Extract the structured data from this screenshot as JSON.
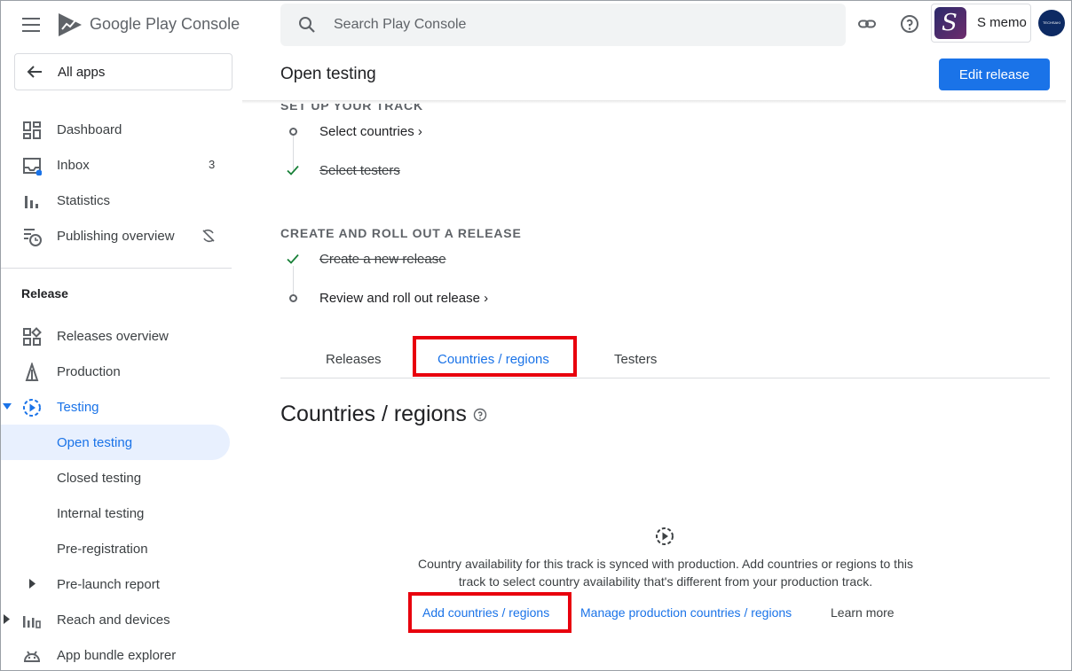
{
  "brand": {
    "name": "Google Play Console"
  },
  "sidebar": {
    "all_apps": "All apps",
    "items": [
      {
        "label": "Dashboard"
      },
      {
        "label": "Inbox",
        "count": "3"
      },
      {
        "label": "Statistics"
      },
      {
        "label": "Publishing overview"
      }
    ],
    "section_release": "Release",
    "release_items": [
      {
        "label": "Releases overview"
      },
      {
        "label": "Production"
      },
      {
        "label": "Testing"
      },
      {
        "label": "Open testing"
      },
      {
        "label": "Closed testing"
      },
      {
        "label": "Internal testing"
      },
      {
        "label": "Pre-registration"
      },
      {
        "label": "Pre-launch report"
      },
      {
        "label": "Reach and devices"
      },
      {
        "label": "App bundle explorer"
      }
    ]
  },
  "topbar": {
    "search_placeholder": "Search Play Console",
    "app_name": "S memo",
    "app_icon_letter": "S",
    "avatar_text": "TECHSAKI"
  },
  "header": {
    "title": "Open testing",
    "edit_release": "Edit release"
  },
  "steps": {
    "setup_heading": "SET UP YOUR TRACK",
    "select_countries": "Select countries ›",
    "select_testers": "Select testers",
    "rollout_heading": "CREATE AND ROLL OUT A RELEASE",
    "create_release": "Create a new release",
    "review_release": "Review and roll out release ›"
  },
  "tabs": [
    {
      "label": "Releases"
    },
    {
      "label": "Countries / regions"
    },
    {
      "label": "Testers"
    }
  ],
  "content": {
    "title": "Countries / regions",
    "description": "Country availability for this track is synced with production. Add countries or regions to this track to select country availability that's different from your production track.",
    "add_link": "Add countries / regions",
    "manage_link": "Manage production countries / regions",
    "learn_more": "Learn more"
  },
  "colors": {
    "accent": "#1a73e8",
    "highlight": "#e8000d",
    "check": "#188038"
  }
}
